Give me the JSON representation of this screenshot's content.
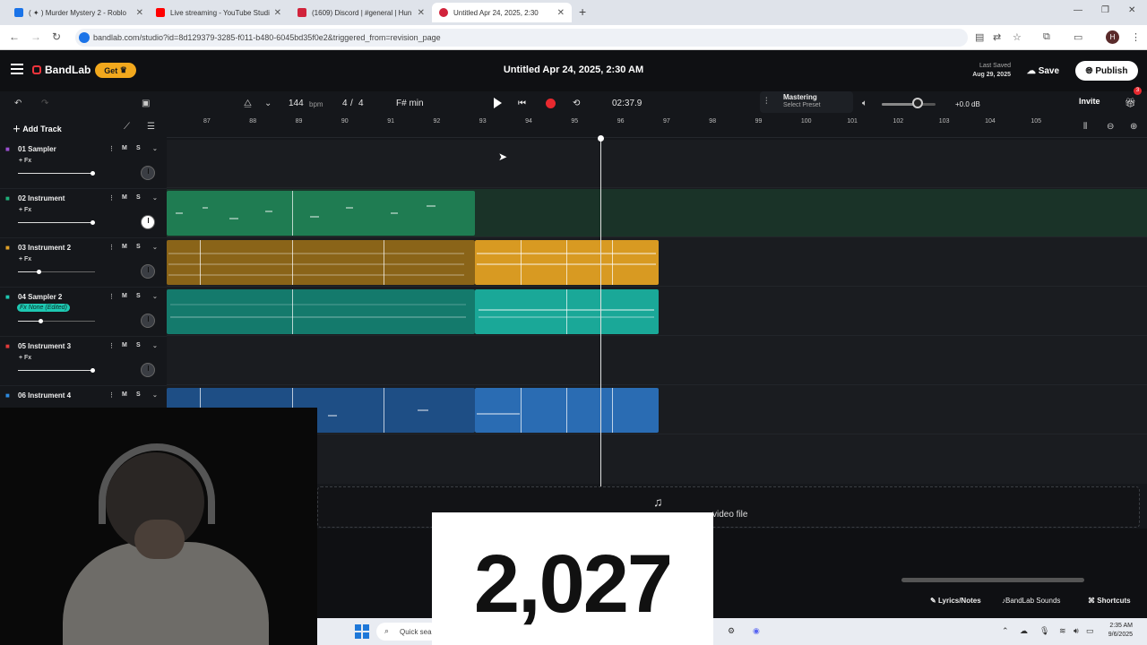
{
  "browser": {
    "tabs": [
      {
        "title": "( ✦ ) Murder Mystery 2 - Roblo",
        "color": "#1a73e8"
      },
      {
        "title": "Live streaming - YouTube Studi",
        "color": "#ff0000"
      },
      {
        "title": "(1609) Discord | #general | Hun",
        "color": "#d1233b"
      },
      {
        "title": "Untitled Apr 24, 2025, 2:30",
        "color": "#d1233b"
      }
    ],
    "url": "bandlab.com/studio?id=8d129379-3285-f011-b480-6045bd35f0e2&triggered_from=revision_page"
  },
  "header": {
    "brand": "BandLab",
    "get_label": "Get",
    "title": "Untitled Apr 24, 2025, 2:30 AM",
    "last_saved_label": "Last Saved",
    "last_saved_date": "Aug 29, 2025",
    "save_label": "Save",
    "publish_label": "Publish"
  },
  "transport": {
    "bpm": "144",
    "bpm_unit": "bpm",
    "time_sig_num": "4",
    "time_sig_sep": "/",
    "time_sig_den": "4",
    "key": "F# min",
    "time": "02:37.9",
    "mastering": "Mastering",
    "mastering_sub": "Select Preset",
    "volume_db": "+0.0 dB",
    "volume_level": 0.62,
    "invite_label": "Invite",
    "notif_count": "3"
  },
  "timeline": {
    "add_track_label": "Add Track",
    "ruler": [
      "87",
      "88",
      "89",
      "90",
      "91",
      "92",
      "93",
      "94",
      "95",
      "96",
      "97",
      "98",
      "99",
      "100",
      "101",
      "102",
      "103",
      "104",
      "105"
    ]
  },
  "tracks": [
    {
      "name": "01  Sampler",
      "fx": "+ Fx",
      "fx_edited": false,
      "color": "#9b4fd1",
      "volume": 0.97
    },
    {
      "name": "02  Instrument",
      "fx": "+ Fx",
      "fx_edited": false,
      "color": "#1fb07a",
      "volume": 0.97
    },
    {
      "name": "03  Instrument 2",
      "fx": "+ Fx",
      "fx_edited": false,
      "color": "#e0a128",
      "volume": 0.27
    },
    {
      "name": "04  Sampler 2",
      "fx": "Fx None (Edited)",
      "fx_edited": true,
      "color": "#1ec8b2",
      "volume": 0.29
    },
    {
      "name": "05  Instrument 3",
      "fx": "+ Fx",
      "fx_edited": false,
      "color": "#e33a3a",
      "volume": 0.97
    },
    {
      "name": "06  Instrument 4",
      "fx": "",
      "fx_edited": false,
      "color": "#2d8ae0",
      "volume": 0.5
    }
  ],
  "track_controls": {
    "mute": "M",
    "solo": "S"
  },
  "dropzone_label": "video file",
  "bottom": {
    "lyrics_label": "Lyrics/Notes",
    "sounds_label": "BandLab Sounds",
    "shortcuts_label": "Shortcuts"
  },
  "taskbar": {
    "search_placeholder": "Quick sea",
    "time": "2:35 AM",
    "date": "9/6/2025"
  },
  "overlay": {
    "counter": "2,027"
  },
  "colors": {
    "accent_get": "#f2a81d",
    "record": "#e8292f"
  }
}
